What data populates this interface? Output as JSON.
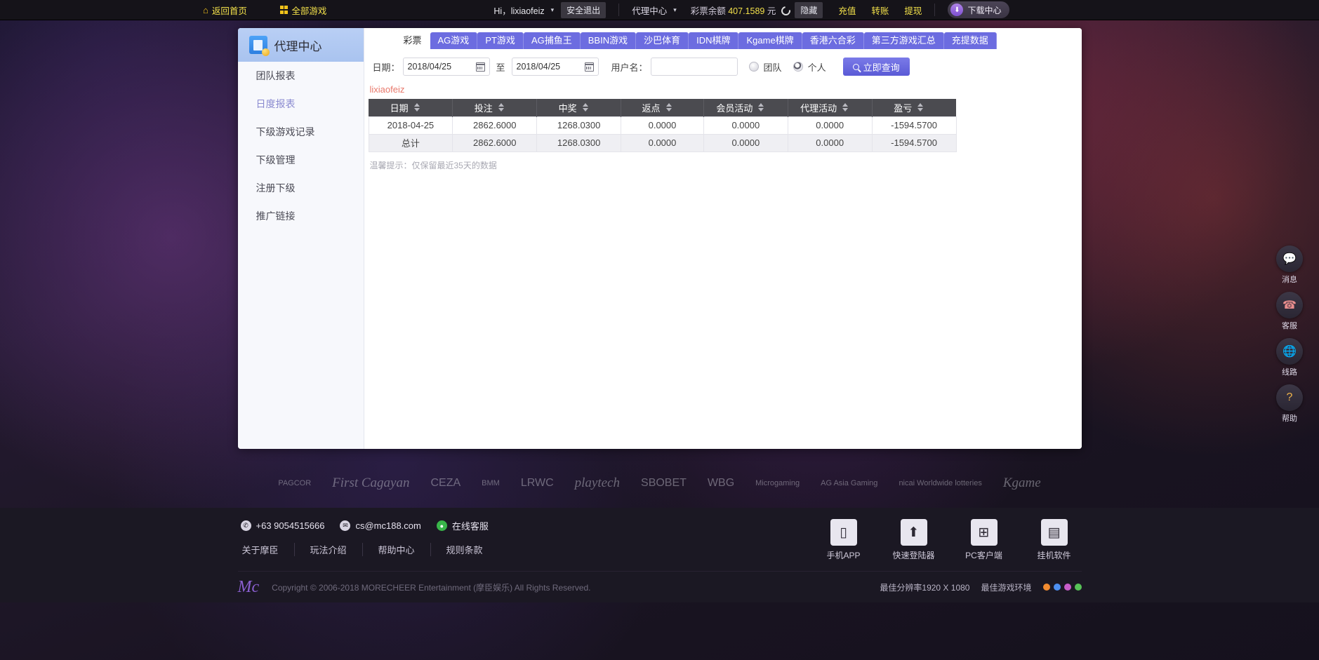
{
  "topbar": {
    "home": "返回首页",
    "all_games": "全部游戏",
    "greeting": "Hi，lixiaofeiz",
    "logout": "安全退出",
    "agent_center": "代理中心",
    "balance_label": "彩票余额",
    "balance_value": "407.1589",
    "balance_unit": "元",
    "hide": "隐藏",
    "deposit": "充值",
    "transfer": "转账",
    "withdraw": "提现",
    "download_center": "下载中心"
  },
  "sidebar": {
    "title": "代理中心",
    "items": [
      {
        "label": "团队报表",
        "active": false
      },
      {
        "label": "日度报表",
        "active": true
      },
      {
        "label": "下级游戏记录",
        "active": false
      },
      {
        "label": "下级管理",
        "active": false
      },
      {
        "label": "注册下级",
        "active": false
      },
      {
        "label": "推广链接",
        "active": false
      }
    ]
  },
  "tabs": [
    {
      "label": "彩票",
      "active": true
    },
    {
      "label": "AG游戏",
      "active": false
    },
    {
      "label": "PT游戏",
      "active": false
    },
    {
      "label": "AG捕鱼王",
      "active": false
    },
    {
      "label": "BBIN游戏",
      "active": false
    },
    {
      "label": "沙巴体育",
      "active": false
    },
    {
      "label": "IDN棋牌",
      "active": false
    },
    {
      "label": "Kgame棋牌",
      "active": false
    },
    {
      "label": "香港六合彩",
      "active": false
    },
    {
      "label": "第三方游戏汇总",
      "active": false
    },
    {
      "label": "充提数据",
      "active": false
    }
  ],
  "filters": {
    "date_label": "日期：",
    "date_from": "2018/04/25",
    "date_to": "2018/04/25",
    "to_label": "至",
    "username_label": "用户名：",
    "username_value": "",
    "username_placeholder": "",
    "radio_team": "团队",
    "radio_person": "个人",
    "selected_radio": "个人",
    "query_button": "立即查询"
  },
  "report": {
    "account": "lixiaofeiz",
    "columns": [
      "日期",
      "投注",
      "中奖",
      "返点",
      "会员活动",
      "代理活动",
      "盈亏"
    ],
    "rows": [
      [
        "2018-04-25",
        "2862.6000",
        "1268.0300",
        "0.0000",
        "0.0000",
        "0.0000",
        "-1594.5700"
      ]
    ],
    "total_row": [
      "总计",
      "2862.6000",
      "1268.0300",
      "0.0000",
      "0.0000",
      "0.0000",
      "-1594.5700"
    ],
    "tip": "温馨提示：仅保留最近35天的数据"
  },
  "rail": [
    {
      "label": "消息",
      "icon": "chat-icon"
    },
    {
      "label": "客服",
      "icon": "headset-icon"
    },
    {
      "label": "线路",
      "icon": "network-icon"
    },
    {
      "label": "帮助",
      "icon": "question-icon"
    }
  ],
  "sponsors": [
    "PAGCOR",
    "First Cagayan",
    "CEZA",
    "BMM",
    "LRWC",
    "playtech",
    "SBOBET",
    "WBG",
    "Microgaming",
    "AG Asia Gaming",
    "nicai Worldwide lotteries",
    "Kgame"
  ],
  "footer": {
    "phone": "+63 9054515666",
    "email": "cs@mc188.com",
    "live_chat": "在线客服",
    "links": [
      "关于摩臣",
      "玩法介绍",
      "帮助中心",
      "规则条款"
    ],
    "apps": [
      {
        "label": "手机APP",
        "icon": "mobile-icon"
      },
      {
        "label": "快速登陆器",
        "icon": "rocket-icon"
      },
      {
        "label": "PC客户端",
        "icon": "windows-icon"
      },
      {
        "label": "挂机软件",
        "icon": "monitor-icon"
      }
    ],
    "copyright": "Copyright © 2006-2018 MORECHEER Entertainment (摩臣娱乐) All Rights Reserved.",
    "resolution": "最佳分辨率1920 X 1080",
    "environment": "最佳游戏环境"
  },
  "colors": {
    "tab_active_bg": "#ffffff",
    "tab_bg": "#6c6ce0",
    "accent_yellow": "#f2e04a",
    "username_red": "#e8786b",
    "table_header": "#4b4b50"
  }
}
